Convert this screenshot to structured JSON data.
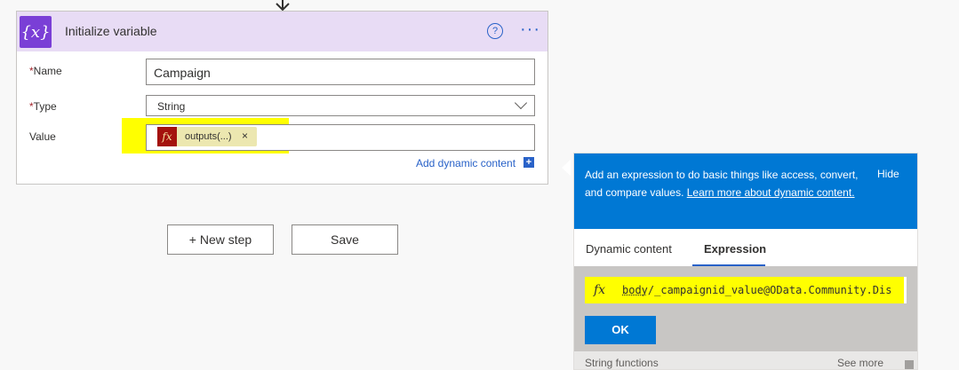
{
  "card": {
    "title": "Initialize variable",
    "icon": "variable-braces-icon",
    "icon_glyph": "{x}",
    "help_icon": "?",
    "more_icon": "···"
  },
  "fields": {
    "name_label": "Name",
    "name_value": "Campaign",
    "type_label": "Type",
    "type_value": "String",
    "value_label": "Value",
    "required_mark": "*",
    "token_label": "outputs(...)",
    "token_close": "×",
    "fx_glyph": "fx",
    "add_dynamic": "Add dynamic content",
    "add_dynamic_icon": "+"
  },
  "actions": {
    "new_step": "+ New step",
    "save": "Save"
  },
  "panel": {
    "info_text": "Add an expression to do basic things like access, convert, and compare values.",
    "learn_more": "Learn more about dynamic content.",
    "hide": "Hide",
    "tabs": [
      "Dynamic content",
      "Expression"
    ],
    "active_tab": "Expression",
    "expression_prefix": "body",
    "expression_rest": "/_campaignid_value@OData.Community.Dis",
    "ok": "OK",
    "functions_label": "String functions",
    "see_more": "See more"
  },
  "colors": {
    "accent": "#0078d4",
    "header": "#e8dcf5",
    "highlight": "#ffff00",
    "expression_badge": "#a4120e"
  }
}
